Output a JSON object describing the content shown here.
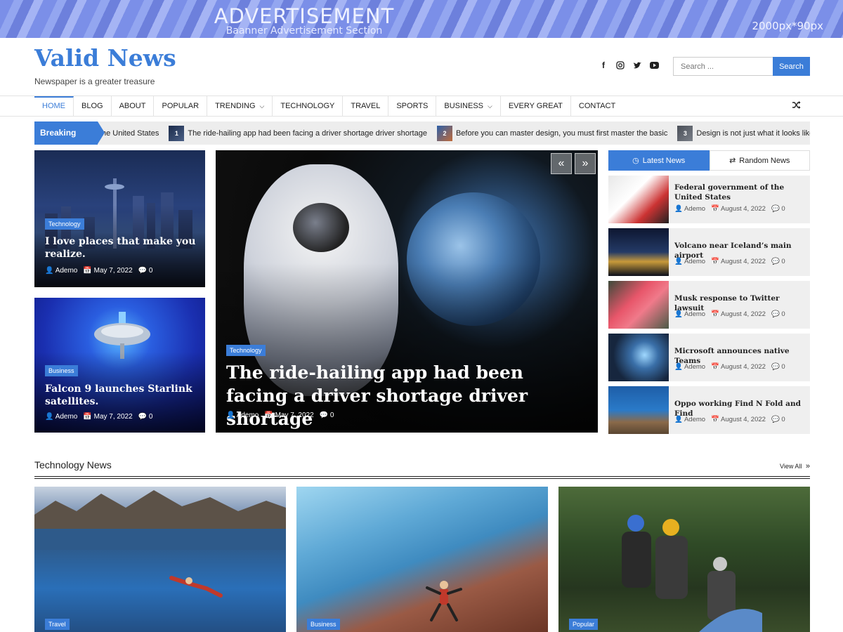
{
  "ad": {
    "title": "ADVERTISEMENT",
    "subtitle": "Baanner Advertisement Section",
    "size": "2000px*90px"
  },
  "site": {
    "title": "Valid News",
    "tagline": "Newspaper is a greater treasure"
  },
  "social": [
    "facebook-icon",
    "instagram-icon",
    "twitter-icon",
    "youtube-icon"
  ],
  "search": {
    "placeholder": "Search ...",
    "button": "Search"
  },
  "nav": {
    "items": [
      {
        "label": "HOME"
      },
      {
        "label": "BLOG"
      },
      {
        "label": "ABOUT"
      },
      {
        "label": "POPULAR"
      },
      {
        "label": "TRENDING"
      },
      {
        "label": "TECHNOLOGY"
      },
      {
        "label": "TRAVEL"
      },
      {
        "label": "SPORTS"
      },
      {
        "label": "BUSINESS"
      },
      {
        "label": "EVERY GREAT"
      },
      {
        "label": "CONTACT"
      }
    ]
  },
  "breaking": {
    "label": "Breaking News",
    "items": [
      {
        "num": "",
        "text": "he United States"
      },
      {
        "num": "1",
        "text": "The ride-hailing app had been facing a driver shortage driver shortage"
      },
      {
        "num": "2",
        "text": "Before you can master design, you must first master the basic"
      },
      {
        "num": "3",
        "text": "Design is not just what it looks like and feels lik"
      }
    ]
  },
  "featured": {
    "left_top": {
      "category": "Technology",
      "title": "I love places that make you realize.",
      "author": "Ademo",
      "date": "May 7, 2022",
      "comments": "0"
    },
    "left_bottom": {
      "category": "Business",
      "title": "Falcon 9 launches Starlink satellites.",
      "author": "Ademo",
      "date": "May 7, 2022",
      "comments": "0"
    },
    "main": {
      "category": "Technology",
      "title": "The ride-hailing app had been facing a driver shortage driver shortage",
      "author": "Ademo",
      "date": "May 7, 2022",
      "comments": "0"
    },
    "prev": "«",
    "next": "»"
  },
  "sidebar": {
    "tabs": [
      {
        "label": "Latest News"
      },
      {
        "label": "Random News"
      }
    ],
    "items": [
      {
        "title": "Federal government of the United States",
        "author": "Ademo",
        "date": "August 4, 2022",
        "comments": "0"
      },
      {
        "title": "Volcano near Iceland’s main airport",
        "author": "Ademo",
        "date": "August 4, 2022",
        "comments": "0"
      },
      {
        "title": "Musk response to Twitter lawsuit",
        "author": "Ademo",
        "date": "August 4, 2022",
        "comments": "0"
      },
      {
        "title": "Microsoft announces native Teams",
        "author": "Ademo",
        "date": "August 4, 2022",
        "comments": "0"
      },
      {
        "title": "Oppo working Find N Fold and Find",
        "author": "Ademo",
        "date": "August 4, 2022",
        "comments": "0"
      }
    ]
  },
  "section": {
    "title": "Technology News",
    "view_all": "View All"
  },
  "bottom_cards": [
    {
      "category": "Travel"
    },
    {
      "category": "Business"
    },
    {
      "category": "Popular"
    }
  ],
  "colors": {
    "accent": "#3b7dd8"
  }
}
